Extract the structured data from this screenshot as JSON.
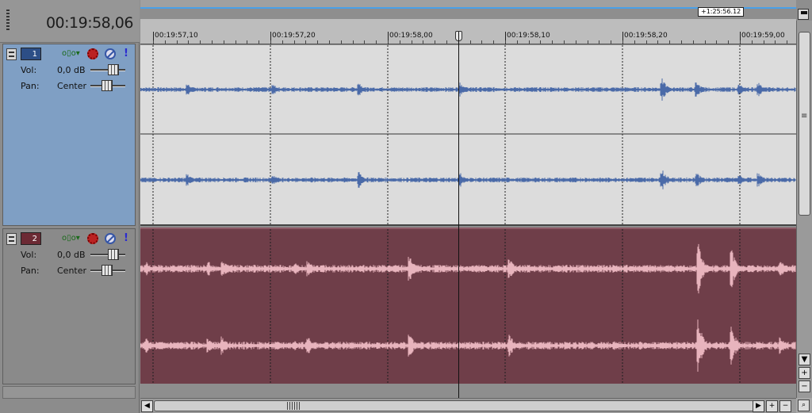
{
  "cursor_time": "00:19:58,06",
  "length_label": "+1:25:56.12",
  "ruler": {
    "labels": [
      "00:19:57,10",
      "00:19:57,20",
      "00:19:58,00",
      "00:19:58,10",
      "00:19:58,20",
      "00:19:59,00"
    ]
  },
  "tracks": [
    {
      "number": "1",
      "vol_label": "Vol:",
      "vol_value": "0,0 dB",
      "pan_label": "Pan:",
      "pan_value": "Center",
      "selected": true,
      "waveform_color": "#4a6aa8",
      "lane_color": "#dcdcdc"
    },
    {
      "number": "2",
      "vol_label": "Vol:",
      "vol_value": "0,0 dB",
      "pan_label": "Pan:",
      "pan_value": "Center",
      "selected": false,
      "waveform_color": "#e8b4bd",
      "lane_color": "#6f3e49"
    }
  ],
  "icons": [
    "minimize-track-icon",
    "envelope-icon",
    "track-fx-icon",
    "mute-icon",
    "solo-icon",
    "marker-flag-icon"
  ],
  "scroll_buttons": {
    "up": "▲",
    "down": "▼",
    "zoom_in": "+",
    "zoom_out": "−",
    "left": "◀",
    "right": "▶",
    "magnify": "🔍"
  }
}
